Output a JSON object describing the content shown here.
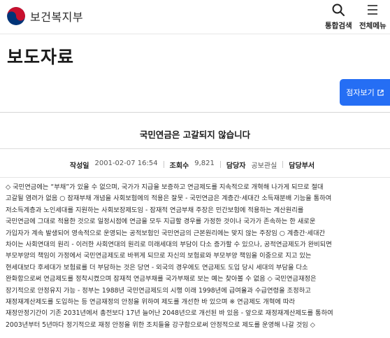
{
  "header": {
    "logo_text": "보건복지부",
    "search_label": "통합검색",
    "menu_label": "전체메뉴",
    "colors": {
      "logo_red": "#c8102e",
      "logo_blue": "#003478"
    }
  },
  "page": {
    "title": "보도자료",
    "ebook_label": "점자보기",
    "accent_color": "#256ef4"
  },
  "article": {
    "title": "국민연금은 고갈되지 않습니다",
    "meta": {
      "date_label": "작성일",
      "date": "2001-02-07 16:54",
      "views_label": "조회수",
      "views": "9,821",
      "author_label": "담당자",
      "author": "공보관실",
      "dept_label": "담당부서"
    },
    "body_lines": [
      "◇ 국민연금에는 “부채”가 있을 수 없으며, 국가가 지급을 보증하고 연금제도를 지속적으로 개혁해 나가게 되므로 절대",
      "고갈될 염려가 없음 ○ 잠재부채 개념을 사회보험에의 적용은 잘못 - 국민연금은 계층간·세대간 소득재분배 기능을 통하여",
      "저소득계층과 노인세대를 지원하는 사회보장제도임 - 잠재적 연금부채 주장은 민간보험에 적용하는 계산원리를",
      "국민연금에 그대로 적용한 것으로 일정시점에 연금을 모두 지급할 경우를 가정한 것이나 국가가 존속하는 한 새로운",
      "가입자가 계속 발생되어 영속적으로 운영되는 공적보험인 국민연금의 근본원리에는 맞지 않는 주장임 ○ 계층간·세대간",
      "차이는 사회연대의 원리 - 이러한 사회연대의 원리로 미래세대의 부담이 다소 증가할 수 있으나, 공적연금제도가 완비되면",
      "부모부양의 책임이 가정에서 국민연금제도로 바뀌게 되므로 자신의 보험료와 부모부양 책임을 이중으로 지고 있는",
      "현세대보다 후세대가 보험료를 더 부담하는 것은 당연 - 외국의 경우에도 연금제도 도입 당시 세대의 부담을 다소",
      "완화함으로써 연금제도를 정착시켰으며 잠재적 연금부채를 국가부채로 보는 예는 찾아볼 수 없음 ◇ 국민연금재정은",
      "장기적으로 안정유지 가능 - 정부는 1988년 국민연금제도의 시행 이래 1998년에 급여율과 수급연령을 조정하고",
      "재정재계산제도를 도입하는 등 연금재정의 안정을 위하여 제도를 개선한 바 있으며 ※ 연금제도 개혁에 따라",
      "재정안정기간이 기존 2031년에서 총전보다 17년 늘어난 2048년으로 개선된 바 있음 - 앞으로 재정재계산제도를 통하여",
      "2003년부터 5년마다 정기적으로 재정 안정을 위한 조치들을 강구함으로써 안정적으로 제도를 운영해 나갈 것임 ◇"
    ]
  }
}
